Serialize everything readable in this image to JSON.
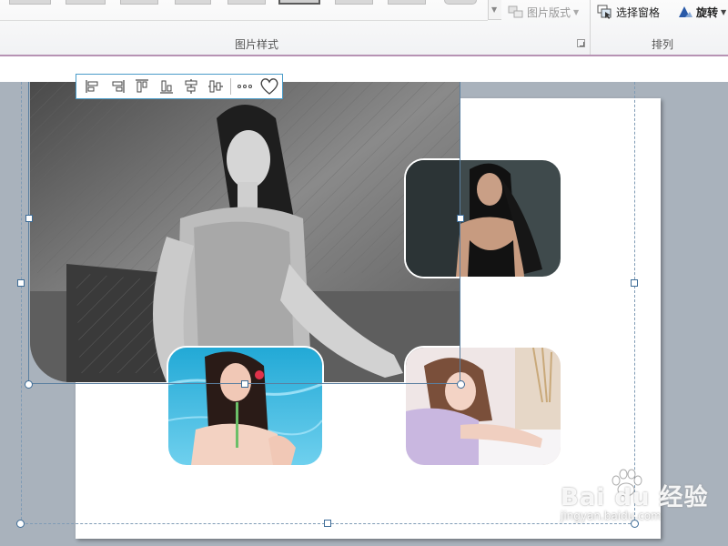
{
  "ribbon": {
    "picture_layout_label": "图片版式",
    "picture_styles_group_label": "图片样式",
    "selection_pane_label": "选择窗格",
    "rotate_label": "旋转",
    "arrange_group_label": "排列"
  },
  "align_toolbar": {
    "tools": [
      {
        "icon": "align-left-icon"
      },
      {
        "icon": "align-right-icon"
      },
      {
        "icon": "align-top-icon"
      },
      {
        "icon": "align-bottom-icon"
      },
      {
        "icon": "align-center-horizontal-icon"
      },
      {
        "icon": "align-middle-vertical-icon"
      },
      {
        "icon": "more-options-icon"
      },
      {
        "icon": "heart-icon"
      }
    ]
  },
  "photos": [
    {
      "name": "grayscale-portrait-photo",
      "tone": "grayscale"
    },
    {
      "name": "dark-portrait-photo",
      "tone": "dark"
    },
    {
      "name": "pool-portrait-photo",
      "tone": "blue"
    },
    {
      "name": "bed-portrait-photo",
      "tone": "light"
    }
  ],
  "watermark": {
    "brand": "Bai du 经验",
    "url": "jingyan.baidu.com"
  },
  "colors": {
    "ribbon_accent": "#b792b3",
    "workspace": "#a9b2bc",
    "selection": "#3d6c97",
    "toolbar_border": "#4a9cc9"
  }
}
